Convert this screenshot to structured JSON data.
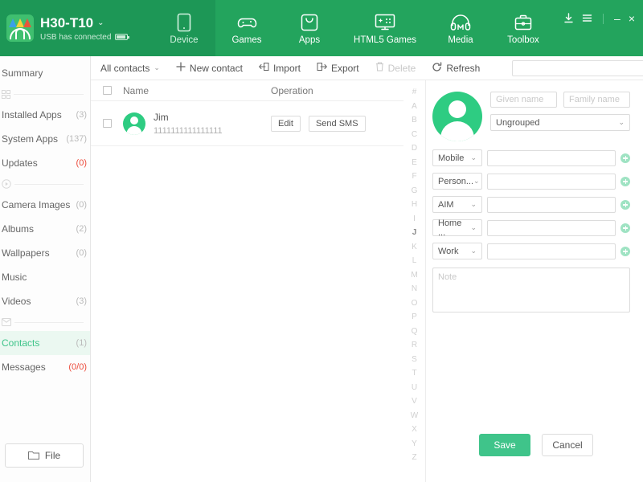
{
  "header": {
    "device_name": "H30-T10",
    "device_chevron": "⌄",
    "connection_status": "USB has connected",
    "logo_icon": "app-logo-icon",
    "battery_icon": "battery-icon",
    "tabs": [
      {
        "label": "Device",
        "icon": "device-phone-icon",
        "active": true
      },
      {
        "label": "Games",
        "icon": "gamepad-icon",
        "active": false
      },
      {
        "label": "Apps",
        "icon": "apps-bag-icon",
        "active": false
      },
      {
        "label": "HTML5 Games",
        "icon": "monitor-icon",
        "active": false
      },
      {
        "label": "Media",
        "icon": "headphones-icon",
        "active": false
      },
      {
        "label": "Toolbox",
        "icon": "toolbox-icon",
        "active": false
      }
    ],
    "window_controls": {
      "download": "download-icon",
      "menu": "hamburger-menu-icon",
      "minimize": "–",
      "close": "×"
    }
  },
  "sidebar": {
    "items": [
      {
        "label": "Summary",
        "count": "",
        "selected": false,
        "type": "item"
      },
      {
        "label": "",
        "count": "",
        "selected": false,
        "type": "separator",
        "icon": "apps-grid-icon"
      },
      {
        "label": "Installed Apps",
        "count": "(3)",
        "selected": false,
        "type": "item"
      },
      {
        "label": "System Apps",
        "count": "(137)",
        "selected": false,
        "type": "item"
      },
      {
        "label": "Updates",
        "count": "(0)",
        "selected": false,
        "type": "item",
        "count_red": true
      },
      {
        "label": "",
        "count": "",
        "selected": false,
        "type": "separator",
        "icon": "play-circle-icon"
      },
      {
        "label": "Camera Images",
        "count": "(0)",
        "selected": false,
        "type": "item"
      },
      {
        "label": "Albums",
        "count": "(2)",
        "selected": false,
        "type": "item"
      },
      {
        "label": "Wallpapers",
        "count": "(0)",
        "selected": false,
        "type": "item"
      },
      {
        "label": "Music",
        "count": "",
        "selected": false,
        "type": "item"
      },
      {
        "label": "Videos",
        "count": "(3)",
        "selected": false,
        "type": "item"
      },
      {
        "label": "",
        "count": "",
        "selected": false,
        "type": "separator",
        "icon": "envelope-icon"
      },
      {
        "label": "Contacts",
        "count": "(1)",
        "selected": true,
        "type": "item"
      },
      {
        "label": "Messages",
        "count": "(0/0)",
        "selected": false,
        "type": "item",
        "count_red": true
      }
    ],
    "file_button": {
      "label": "File",
      "icon": "folder-icon"
    }
  },
  "toolbar": {
    "filter_label": "All contacts",
    "filter_chevron": "⌄",
    "new_contact": "New contact",
    "import": "Import",
    "export": "Export",
    "delete": "Delete",
    "refresh": "Refresh",
    "search_placeholder": "",
    "search_value": "",
    "icons": {
      "new": "plus-icon",
      "import": "import-arrow-icon",
      "export": "export-arrow-icon",
      "delete": "trash-icon",
      "refresh": "refresh-icon",
      "search": "search-icon"
    }
  },
  "contact_list": {
    "columns": {
      "name": "Name",
      "operation": "Operation"
    },
    "rows": [
      {
        "name": "Jim",
        "phone": "1111111111111111",
        "checked": false,
        "edit_label": "Edit",
        "sms_label": "Send SMS"
      }
    ]
  },
  "alpha_index": {
    "letters": [
      "#",
      "A",
      "B",
      "C",
      "D",
      "E",
      "F",
      "G",
      "H",
      "I",
      "J",
      "K",
      "L",
      "M",
      "N",
      "O",
      "P",
      "Q",
      "R",
      "S",
      "T",
      "U",
      "V",
      "W",
      "X",
      "Y",
      "Z"
    ],
    "active": "J"
  },
  "detail": {
    "avatar_icon": "contact-avatar-icon",
    "given_name": {
      "value": "",
      "placeholder": "Given name"
    },
    "family_name": {
      "value": "",
      "placeholder": "Family name"
    },
    "group": {
      "value": "Ungrouped",
      "chevron": "⌄"
    },
    "fields": [
      {
        "type": "Mobile",
        "value": "",
        "chevron": "⌄",
        "add_icon": "add-field-icon"
      },
      {
        "type": "Person...",
        "value": "",
        "chevron": "⌄",
        "add_icon": "add-field-icon"
      },
      {
        "type": "AIM",
        "value": "",
        "chevron": "⌄",
        "add_icon": "add-field-icon"
      },
      {
        "type": "Home ...",
        "value": "",
        "chevron": "⌄",
        "add_icon": "add-field-icon"
      },
      {
        "type": "Work",
        "value": "",
        "chevron": "⌄",
        "add_icon": "add-field-icon"
      }
    ],
    "note": {
      "value": "",
      "placeholder": "Note"
    },
    "save_label": "Save",
    "cancel_label": "Cancel"
  },
  "colors": {
    "header_green": "#23a45d",
    "active_tab_green": "#1d9756",
    "accent_green": "#3fc48a",
    "selected_bg": "#ebf8f1",
    "danger_red": "#ec4b3c"
  }
}
